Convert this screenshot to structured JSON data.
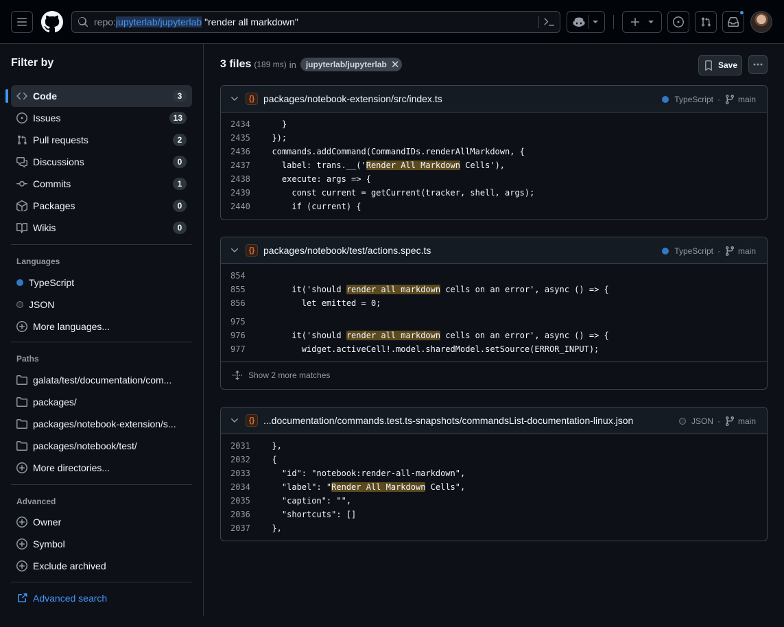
{
  "header": {
    "search_prefix": "repo:",
    "search_repo": "jupyterlab/jupyterlab",
    "search_query": " \"render all markdown\""
  },
  "sidebar": {
    "title": "Filter by",
    "types": [
      {
        "label": "Code",
        "count": "3",
        "icon": "code-icon"
      },
      {
        "label": "Issues",
        "count": "13",
        "icon": "issue-opened-icon"
      },
      {
        "label": "Pull requests",
        "count": "2",
        "icon": "git-pull-request-icon"
      },
      {
        "label": "Discussions",
        "count": "0",
        "icon": "comment-discussion-icon"
      },
      {
        "label": "Commits",
        "count": "1",
        "icon": "git-commit-icon"
      },
      {
        "label": "Packages",
        "count": "0",
        "icon": "package-icon"
      },
      {
        "label": "Wikis",
        "count": "0",
        "icon": "book-icon"
      }
    ],
    "languages_title": "Languages",
    "languages": [
      {
        "label": "TypeScript",
        "color": "#3178c6"
      },
      {
        "label": "JSON",
        "color": "#292929"
      }
    ],
    "more_languages": "More languages...",
    "paths_title": "Paths",
    "paths": [
      "galata/test/documentation/com...",
      "packages/",
      "packages/notebook-extension/s...",
      "packages/notebook/test/"
    ],
    "more_directories": "More directories...",
    "advanced_title": "Advanced",
    "advanced": [
      "Owner",
      "Symbol",
      "Exclude archived"
    ],
    "advanced_search": "Advanced search"
  },
  "results": {
    "count": "3 files",
    "time": "(189 ms)",
    "in": "in",
    "repo": "jupyterlab/jupyterlab",
    "save_label": "Save"
  },
  "files": [
    {
      "path": "packages/notebook-extension/src/index.ts",
      "language": "TypeScript",
      "language_color": "#3178c6",
      "branch": "main",
      "lines": [
        {
          "n": "2434",
          "code": "    }"
        },
        {
          "n": "2435",
          "code": "  });"
        },
        {
          "n": "2436",
          "code": "  commands.addCommand(CommandIDs.renderAllMarkdown, {"
        },
        {
          "n": "2437",
          "code": "    label: trans.__('Render All Markdown Cells'),"
        },
        {
          "n": "2438",
          "code": "    execute: args => {"
        },
        {
          "n": "2439",
          "code": "      const current = getCurrent(tracker, shell, args);"
        },
        {
          "n": "2440",
          "code": "      if (current) {"
        }
      ]
    },
    {
      "path": "packages/notebook/test/actions.spec.ts",
      "language": "TypeScript",
      "language_color": "#3178c6",
      "branch": "main",
      "lines": [
        {
          "n": "854",
          "code": ""
        },
        {
          "n": "855",
          "code": "      it('should render all markdown cells on an error', async () => {"
        },
        {
          "n": "856",
          "code": "        let emitted = 0;"
        },
        {
          "n": "975",
          "code": ""
        },
        {
          "n": "976",
          "code": "      it('should render all markdown cells on an error', async () => {"
        },
        {
          "n": "977",
          "code": "        widget.activeCell!.model.sharedModel.setSource(ERROR_INPUT);"
        }
      ],
      "more_matches": "Show 2 more matches"
    },
    {
      "path": "...documentation/commands.test.ts-snapshots/commandsList-documentation-linux.json",
      "language": "JSON",
      "language_color": "#292929",
      "branch": "main",
      "lines": [
        {
          "n": "2031",
          "code": "  },"
        },
        {
          "n": "2032",
          "code": "  {"
        },
        {
          "n": "2033",
          "code": "    \"id\": \"notebook:render-all-markdown\","
        },
        {
          "n": "2034",
          "code": "    \"label\": \"Render All Markdown Cells\","
        },
        {
          "n": "2035",
          "code": "    \"caption\": \"\","
        },
        {
          "n": "2036",
          "code": "    \"shortcuts\": []"
        },
        {
          "n": "2037",
          "code": "  },"
        }
      ]
    }
  ]
}
